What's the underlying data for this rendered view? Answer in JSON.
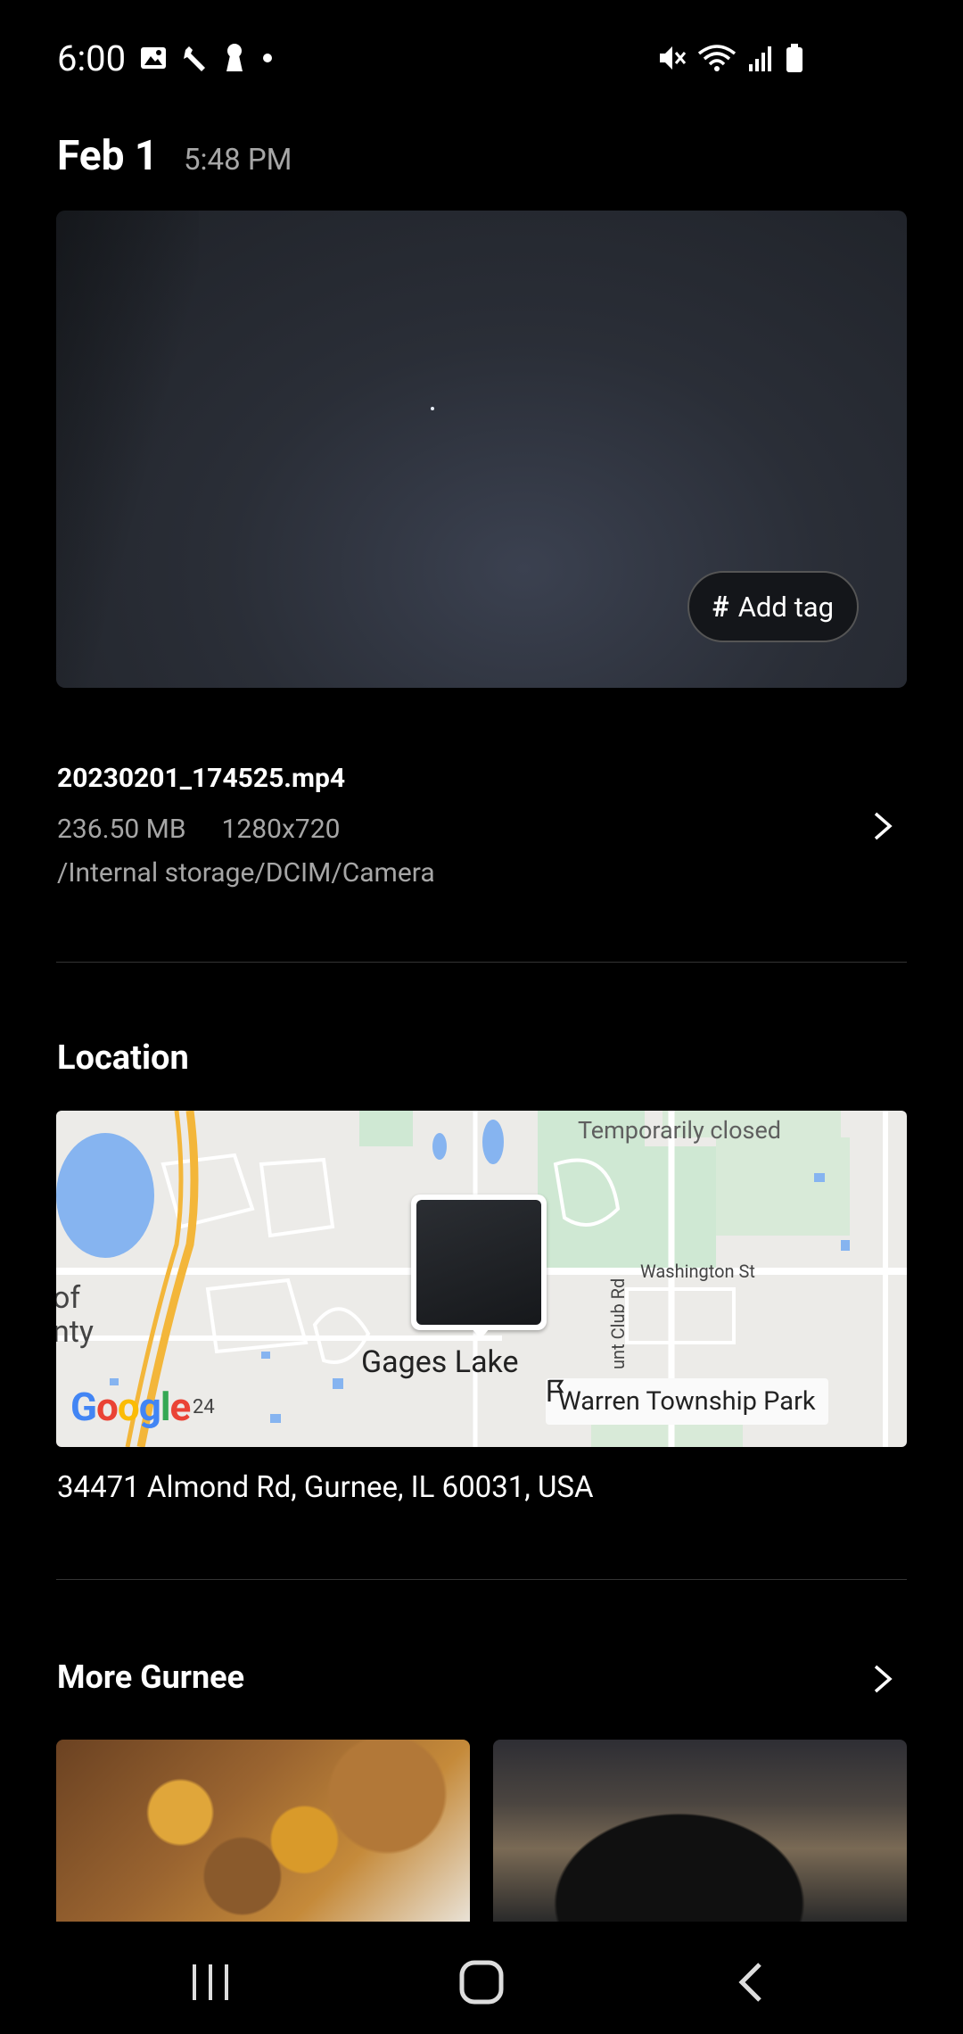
{
  "status_bar": {
    "time": "6:00",
    "left_icons": [
      "gallery-icon",
      "wrench-icon",
      "keyhole-icon",
      "dot-icon"
    ],
    "right_icons": [
      "mute-icon",
      "wifi-icon",
      "signal-icon",
      "battery-icon"
    ]
  },
  "header": {
    "date": "Feb 1",
    "time": "5:48 PM"
  },
  "preview": {
    "add_tag_label": "Add tag"
  },
  "file": {
    "name": "20230201_174525.mp4",
    "size": "236.50 MB",
    "resolution": "1280x720",
    "path": "/Internal storage/DCIM/Camera"
  },
  "location": {
    "title": "Location",
    "map": {
      "temporarily_closed": "Temporarily closed",
      "street_label": "Washington St",
      "vertical_street": "unt Club Rd",
      "place_label": "Gages Lake",
      "left_cut_1": "of",
      "left_cut_2": "nty",
      "route_number": "24",
      "park_label": "Warren Township Park",
      "provider": "Google"
    },
    "address": "34471 Almond Rd, Gurnee, IL 60031, USA"
  },
  "more": {
    "title": "More Gurnee"
  },
  "nav": [
    "recents-icon",
    "home-icon",
    "back-icon"
  ]
}
